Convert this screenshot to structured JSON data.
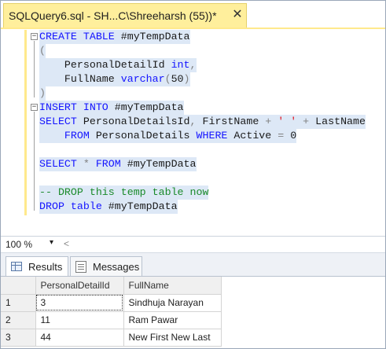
{
  "tab": {
    "title": "SQLQuery6.sql - SH...C\\Shreeharsh (55))*",
    "close_glyph": "✕"
  },
  "editor": {
    "lines": {
      "l1": [
        {
          "t": "CREATE TABLE ",
          "c": "kw"
        },
        {
          "t": "#myTempData",
          "c": "id"
        }
      ],
      "l2": [
        {
          "t": "(",
          "c": "op"
        }
      ],
      "l3": [
        {
          "t": "    PersonalDetailId ",
          "c": "id"
        },
        {
          "t": "int",
          "c": "kw"
        },
        {
          "t": ",",
          "c": "op"
        }
      ],
      "l4": [
        {
          "t": "    FullName ",
          "c": "id"
        },
        {
          "t": "varchar",
          "c": "kw"
        },
        {
          "t": "(",
          "c": "op"
        },
        {
          "t": "50",
          "c": "id"
        },
        {
          "t": ")",
          "c": "op"
        }
      ],
      "l5": [
        {
          "t": ")",
          "c": "op"
        }
      ],
      "l6": [
        {
          "t": "INSERT INTO ",
          "c": "kw"
        },
        {
          "t": "#myTempData",
          "c": "id"
        }
      ],
      "l7": [
        {
          "t": "SELECT ",
          "c": "kw"
        },
        {
          "t": "PersonalDetailsId",
          "c": "id"
        },
        {
          "t": ", ",
          "c": "op"
        },
        {
          "t": "FirstName ",
          "c": "id"
        },
        {
          "t": "+ ",
          "c": "op"
        },
        {
          "t": "' '",
          "c": "str"
        },
        {
          "t": " + ",
          "c": "op"
        },
        {
          "t": "LastName",
          "c": "id"
        }
      ],
      "l8": [
        {
          "t": "    FROM ",
          "c": "kw"
        },
        {
          "t": "PersonalDetails ",
          "c": "id"
        },
        {
          "t": "WHERE ",
          "c": "kw"
        },
        {
          "t": "Active ",
          "c": "id"
        },
        {
          "t": "= ",
          "c": "op"
        },
        {
          "t": "0",
          "c": "id"
        }
      ],
      "l9": [
        {
          "t": "SELECT ",
          "c": "kw"
        },
        {
          "t": "* ",
          "c": "op"
        },
        {
          "t": "FROM ",
          "c": "kw"
        },
        {
          "t": "#myTempData",
          "c": "id"
        }
      ],
      "l10": [
        {
          "t": "-- DROP this temp table now",
          "c": "cm"
        }
      ],
      "l11": [
        {
          "t": "DROP table ",
          "c": "kw"
        },
        {
          "t": "#myTempData",
          "c": "id"
        }
      ]
    },
    "collapse_glyph": "−"
  },
  "zoom": {
    "value": "100 %",
    "dropdown_glyph": "▾",
    "scroll_left_glyph": "<"
  },
  "results_tabs": {
    "results": "Results",
    "messages": "Messages"
  },
  "grid": {
    "columns": [
      "PersonalDetailId",
      "FullName"
    ],
    "rows": [
      {
        "n": "1",
        "id": "3",
        "name": "Sindhuja Narayan"
      },
      {
        "n": "2",
        "id": "11",
        "name": "Ram Pawar"
      },
      {
        "n": "3",
        "id": "44",
        "name": "New First New Last"
      }
    ]
  },
  "colors": {
    "tab_active": "#ffef9c",
    "selection": "#dde8f6",
    "keyword": "#1414ff",
    "comment": "#1a8a2a",
    "string": "#e0141e"
  },
  "icons": {
    "results_tab": "grid-icon",
    "messages_tab": "messages-icon",
    "close": "close-icon"
  }
}
